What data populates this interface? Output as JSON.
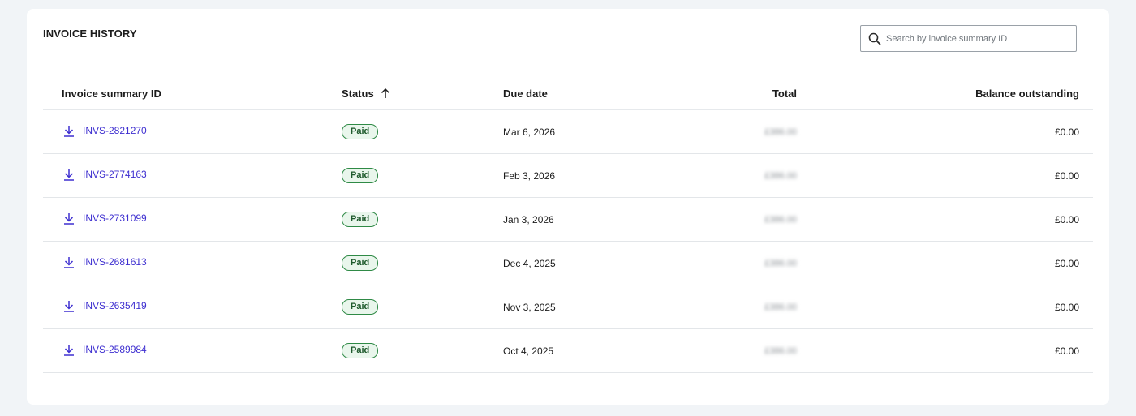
{
  "card": {
    "title": "INVOICE HISTORY"
  },
  "search": {
    "placeholder": "Search by invoice summary ID",
    "value": ""
  },
  "table": {
    "headers": {
      "id": "Invoice summary ID",
      "status": "Status",
      "due": "Due date",
      "total": "Total",
      "balance": "Balance outstanding"
    },
    "sort_icon": "arrow-up-icon",
    "rows": [
      {
        "id": "INVS-2821270",
        "status": "Paid",
        "due": "Mar 6, 2026",
        "total": "£386.00",
        "balance": "£0.00"
      },
      {
        "id": "INVS-2774163",
        "status": "Paid",
        "due": "Feb 3, 2026",
        "total": "£386.00",
        "balance": "£0.00"
      },
      {
        "id": "INVS-2731099",
        "status": "Paid",
        "due": "Jan 3, 2026",
        "total": "£386.00",
        "balance": "£0.00"
      },
      {
        "id": "INVS-2681613",
        "status": "Paid",
        "due": "Dec 4, 2025",
        "total": "£386.00",
        "balance": "£0.00"
      },
      {
        "id": "INVS-2635419",
        "status": "Paid",
        "due": "Nov 3, 2025",
        "total": "£386.00",
        "balance": "£0.00"
      },
      {
        "id": "INVS-2589984",
        "status": "Paid",
        "due": "Oct 4, 2025",
        "total": "£386.00",
        "balance": "£0.00"
      }
    ]
  },
  "colors": {
    "link": "#3e2fd0",
    "badge_border": "#2f8a46",
    "badge_bg": "#e9f6ec",
    "badge_text": "#1e5a2c",
    "page_bg": "#f1f4f7"
  },
  "icons": {
    "search": "search-icon",
    "download": "download-icon"
  }
}
